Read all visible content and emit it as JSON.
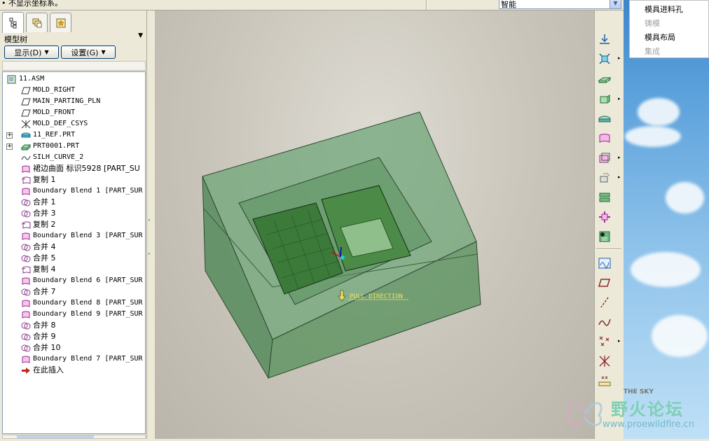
{
  "top": {
    "status_text": "• 不显示坐标系。",
    "filter_value": "智能"
  },
  "left": {
    "tree_title": "模型树",
    "display_button": "显示(D)",
    "settings_button": "设置(G)",
    "nodes": [
      {
        "label": "11.ASM",
        "icon": "assembly-icon"
      },
      {
        "label": "MOLD_RIGHT",
        "icon": "datum-plane-icon"
      },
      {
        "label": "MAIN_PARTING_PLN",
        "icon": "datum-plane-icon"
      },
      {
        "label": "MOLD_FRONT",
        "icon": "datum-plane-icon"
      },
      {
        "label": "MOLD_DEF_CSYS",
        "icon": "csys-icon"
      },
      {
        "label": "11_REF.PRT",
        "icon": "ref-part-icon"
      },
      {
        "label": "PRT0001.PRT",
        "icon": "workpiece-icon"
      },
      {
        "label": "SILH_CURVE_2",
        "icon": "curve-icon"
      },
      {
        "label": "裙边曲面 标识5928 [PART_SU",
        "icon": "surface-icon"
      },
      {
        "label": "复制 1",
        "icon": "copy-surface-icon"
      },
      {
        "label": "Boundary Blend 1 [PART_SUR",
        "icon": "surface-icon"
      },
      {
        "label": "合并 1",
        "icon": "merge-icon"
      },
      {
        "label": "合并 3",
        "icon": "merge-icon"
      },
      {
        "label": "复制 2",
        "icon": "copy-surface-icon"
      },
      {
        "label": "Boundary Blend 3 [PART_SUR",
        "icon": "surface-icon"
      },
      {
        "label": "合并 4",
        "icon": "merge-icon"
      },
      {
        "label": "合并 5",
        "icon": "merge-icon"
      },
      {
        "label": "复制 4",
        "icon": "copy-surface-icon"
      },
      {
        "label": "Boundary Blend 6 [PART_SUR",
        "icon": "surface-icon"
      },
      {
        "label": "合并 7",
        "icon": "merge-icon"
      },
      {
        "label": "Boundary Blend 8 [PART_SUR",
        "icon": "surface-icon"
      },
      {
        "label": "Boundary Blend 9 [PART_SUR",
        "icon": "surface-icon"
      },
      {
        "label": "合并 8",
        "icon": "merge-icon"
      },
      {
        "label": "合并 9",
        "icon": "merge-icon"
      },
      {
        "label": "合并 10",
        "icon": "merge-icon"
      },
      {
        "label": "Boundary Blend 7 [PART_SUR",
        "icon": "surface-icon"
      },
      {
        "label": "在此插入",
        "icon": "insert-here-arrow-icon"
      }
    ]
  },
  "viewport": {
    "pull_direction_label": "PULL DIRECTION",
    "mold_color": "#5e9a68",
    "part_color": "#3f7a3c"
  },
  "menu": {
    "items": [
      {
        "label": "模具进料孔",
        "enabled": true
      },
      {
        "label": "铸模",
        "enabled": false
      },
      {
        "label": "模具布局",
        "enabled": true
      },
      {
        "label": "集成",
        "enabled": false
      }
    ]
  },
  "watermark": {
    "sky_text": "THE SKY",
    "logo_text": "野火论坛",
    "url": "www.proewildfire.cn"
  }
}
